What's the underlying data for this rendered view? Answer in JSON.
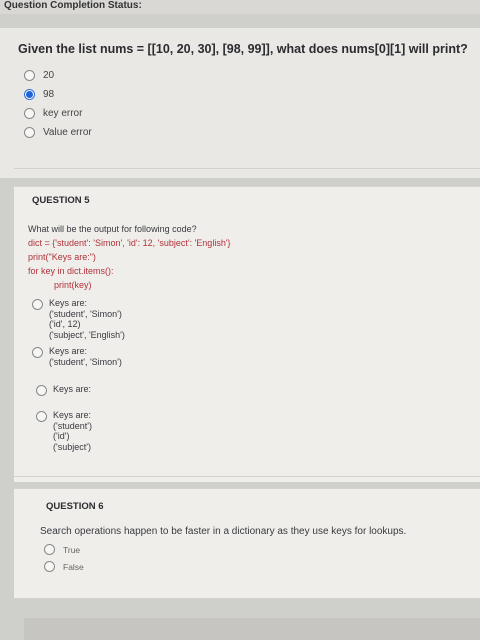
{
  "header": {
    "title": "Question Completion Status:"
  },
  "question4": {
    "prompt": "Given the list nums = [[10, 20, 30], [98, 99]], what does nums[0][1] will print?",
    "options": [
      {
        "label": "20",
        "selected": false
      },
      {
        "label": "98",
        "selected": true
      },
      {
        "label": "key error",
        "selected": false
      },
      {
        "label": "Value error",
        "selected": false
      }
    ]
  },
  "question5": {
    "heading": "QUESTION 5",
    "prompt": "What will be the output for following code?",
    "code": [
      "dict = {'student': 'Simon', 'id': 12, 'subject': 'English'}",
      "print(\"Keys are:\")",
      "for key in dict.items():",
      "print(key)"
    ],
    "options": [
      {
        "lines": [
          "Keys are:",
          "('student', 'Simon')",
          "('id', 12)",
          "('subject', 'English')"
        ]
      },
      {
        "lines": [
          "Keys are:",
          "('student', 'Simon')"
        ]
      },
      {
        "lines": [
          "Keys are:"
        ]
      },
      {
        "lines": [
          "Keys are:",
          "('student')",
          "('id')",
          "('subject')"
        ]
      }
    ]
  },
  "question6": {
    "heading": "QUESTION 6",
    "prompt": "Search operations happen to be faster in a dictionary as they use keys for lookups.",
    "options": [
      {
        "label": "True"
      },
      {
        "label": "False"
      }
    ]
  },
  "colors": {
    "selected_radio": "#1f63d8",
    "code_red": "#b0323a"
  }
}
